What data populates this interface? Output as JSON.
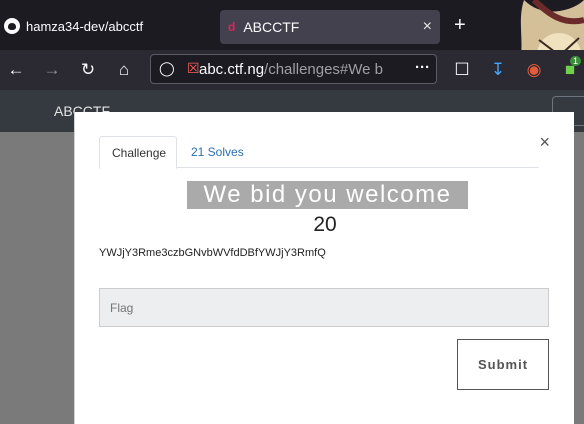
{
  "browser": {
    "window_title": "hamza34-dev/abcctf",
    "tab_title": "ABCCTF",
    "tab_close": "×",
    "new_tab": "+",
    "url_host": "abc.ctf.ng",
    "url_path": "/challenges#We b",
    "url_menu": "···",
    "extension_badge": "1"
  },
  "app": {
    "brand": "ABCCTF"
  },
  "modal": {
    "close": "×",
    "tabs": [
      "Challenge",
      "21 Solves"
    ],
    "challenge_name": "We bid you welcome",
    "points": "20",
    "description": "YWJjY3Rme3czbGNvbWVfdDBfYWJjY3RmfQ",
    "flag_placeholder": "Flag",
    "submit_label": "Submit"
  },
  "colors": {
    "title_bar": "#1c1b22",
    "nav_bar": "#2b2a33",
    "app_bar": "#343a40",
    "backdrop": "#7a7a7a",
    "link_blue": "#2a6fb0"
  }
}
